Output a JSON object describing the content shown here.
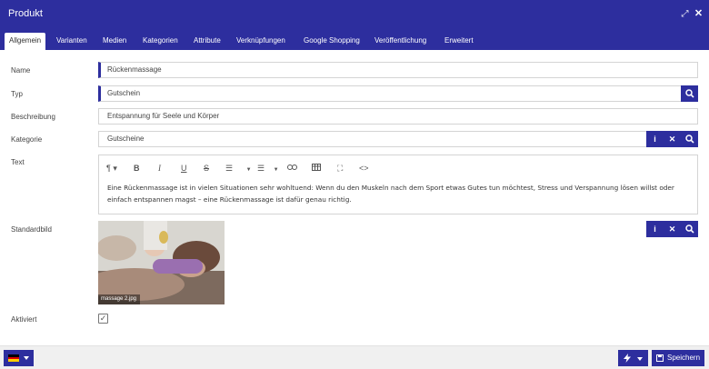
{
  "window": {
    "title": "Produkt",
    "expand_icon": "expand-icon",
    "close_icon": "close-icon"
  },
  "tabs": [
    {
      "label": "Allgemein",
      "active": true
    },
    {
      "label": "Varianten",
      "active": false
    },
    {
      "label": "Medien",
      "active": false
    },
    {
      "label": "Kategorien",
      "active": false
    },
    {
      "label": "Attribute",
      "active": false
    },
    {
      "label": "Verknüpfungen",
      "active": false
    },
    {
      "label": "Google Shopping",
      "active": false
    },
    {
      "label": "Veröffentlichung",
      "active": false
    },
    {
      "label": "Erweitert",
      "active": false
    }
  ],
  "form": {
    "name": {
      "label": "Name",
      "value": "Rückenmassage"
    },
    "typ": {
      "label": "Typ",
      "value": "Gutschein"
    },
    "beschreibung": {
      "label": "Beschreibung",
      "value": "Entspannung für Seele und Körper"
    },
    "kategorie": {
      "label": "Kategorie",
      "value": "Gutscheine"
    },
    "text": {
      "label": "Text",
      "toolbar": [
        "paragraph-icon",
        "bold-icon",
        "italic-icon",
        "underline-icon",
        "strikethrough-icon",
        "ordered-list-icon",
        "unordered-list-icon",
        "link-icon",
        "table-icon",
        "fullscreen-icon",
        "code-icon"
      ],
      "content": "Eine Rückenmassage ist in vielen Situationen sehr wohltuend: Wenn du den Muskeln nach dem Sport etwas Gutes tun möchtest, Stress und Verspannung lösen willst oder einfach entspannen magst – eine Rückenmassage ist dafür genau richtig."
    },
    "standardbild": {
      "label": "Standardbild",
      "filename": "massage 2.jpg"
    },
    "aktiviert": {
      "label": "Aktiviert",
      "checked": true
    }
  },
  "footer": {
    "language_flag": "flag-de-icon",
    "action_icon": "lightning-icon",
    "save_label": "Speichern",
    "save_icon": "save-icon"
  },
  "colors": {
    "primary": "#2d2e9e",
    "footer_bg": "#f0f0f0",
    "border": "#d4d4d4"
  }
}
